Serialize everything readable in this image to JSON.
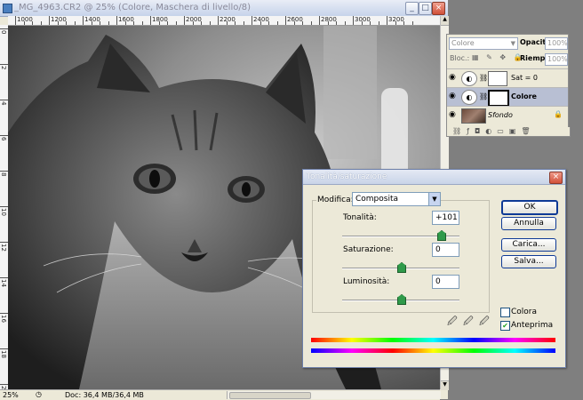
{
  "document": {
    "title": "_MG_4963.CR2 @ 25% (Colore, Maschera di livello/8)",
    "ruler_h_labels": [
      "1000",
      "1200",
      "1400",
      "1600",
      "1800",
      "2000",
      "2200",
      "2400",
      "2600",
      "2800",
      "3000",
      "3200"
    ],
    "ruler_v_labels": [
      "0",
      "2",
      "4",
      "6",
      "8",
      "10",
      "12",
      "14",
      "16",
      "18",
      "20"
    ],
    "zoom": "25%",
    "doc_info": "Doc: 36,4 MB/36,4 MB"
  },
  "layers_panel": {
    "blend_mode": "Colore",
    "opacity_label": "Opacità:",
    "opacity_value": "100%",
    "lock_label": "Bloc.:",
    "fill_label": "Riemp.:",
    "fill_value": "100%",
    "layers": [
      {
        "name": "Sat = 0"
      },
      {
        "name": "Colore"
      },
      {
        "name": "Sfondo"
      }
    ]
  },
  "dialog": {
    "title": "Tonalità/saturazione",
    "modifica_label": "Modifica:",
    "modifica_value": "Composita",
    "hue_label": "Tonalità:",
    "hue_value": "+101",
    "sat_label": "Saturazione:",
    "sat_value": "0",
    "light_label": "Luminosità:",
    "light_value": "0",
    "buttons": {
      "ok": "OK",
      "cancel": "Annulla",
      "load": "Carica...",
      "save": "Salva..."
    },
    "colorize_label": "Colora",
    "preview_label": "Anteprima",
    "colorize_checked": false,
    "preview_checked": true
  },
  "colors": {
    "accent": "#0f3a96",
    "slider_thumb": "#2f9a4a"
  }
}
